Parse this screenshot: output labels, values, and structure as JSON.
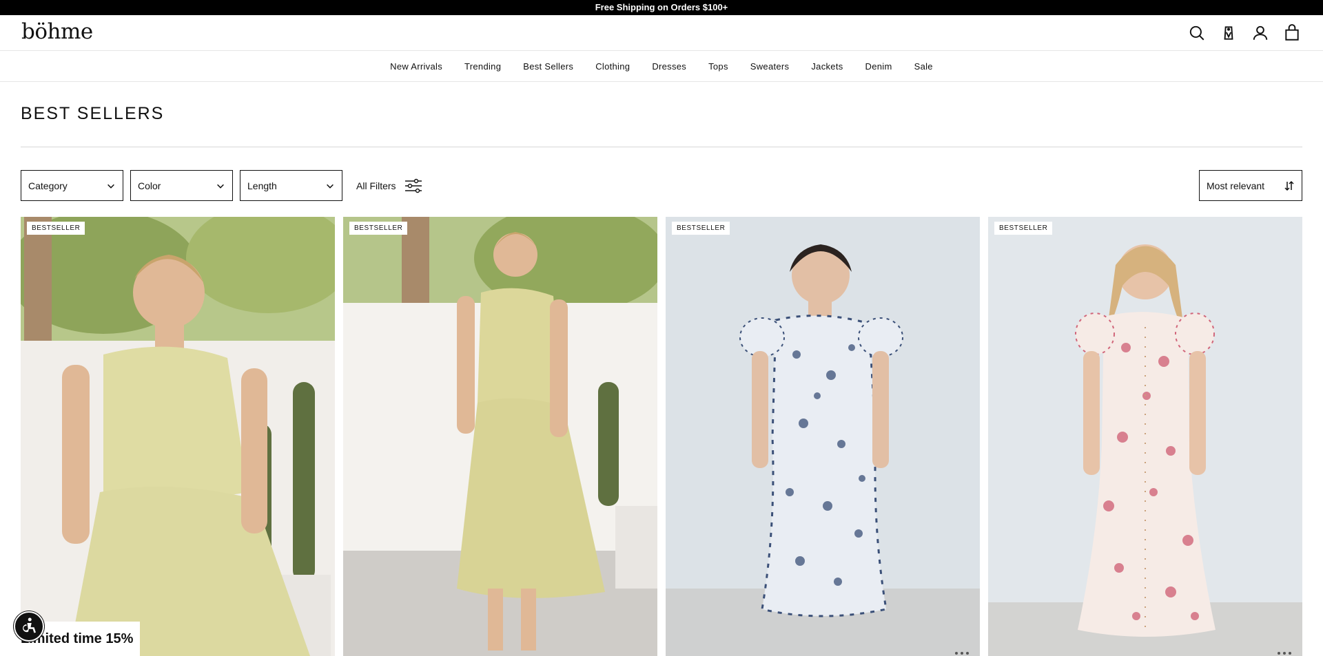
{
  "promo_bar": {
    "text": "Free Shipping on Orders $100+"
  },
  "header": {
    "logo": "böhme"
  },
  "nav": {
    "items": [
      "New Arrivals",
      "Trending",
      "Best Sellers",
      "Clothing",
      "Dresses",
      "Tops",
      "Sweaters",
      "Jackets",
      "Denim",
      "Sale"
    ]
  },
  "page": {
    "title": "BEST SELLERS"
  },
  "filters": {
    "category": "Category",
    "color": "Color",
    "length": "Length",
    "all_filters": "All Filters"
  },
  "sort": {
    "label": "Most relevant"
  },
  "products": [
    {
      "badge": "BESTSELLER",
      "dress_color": "#dfdca3",
      "bg": "#f2eee8"
    },
    {
      "badge": "BESTSELLER",
      "dress_color": "#dcd79a",
      "bg": "#ece8e3"
    },
    {
      "badge": "BESTSELLER",
      "dress_color": "#e9edf3",
      "bg": "#dde3e8"
    },
    {
      "badge": "BESTSELLER",
      "dress_color": "#f6e6e3",
      "bg": "#e1e6ea"
    }
  ],
  "popup": {
    "text": "Limited time 15%"
  },
  "icons": [
    "search-icon",
    "wishlist-tag-icon",
    "account-icon",
    "cart-bag-icon",
    "chevron-down-icon",
    "filter-sliders-icon",
    "sort-arrows-icon",
    "accessibility-icon"
  ]
}
